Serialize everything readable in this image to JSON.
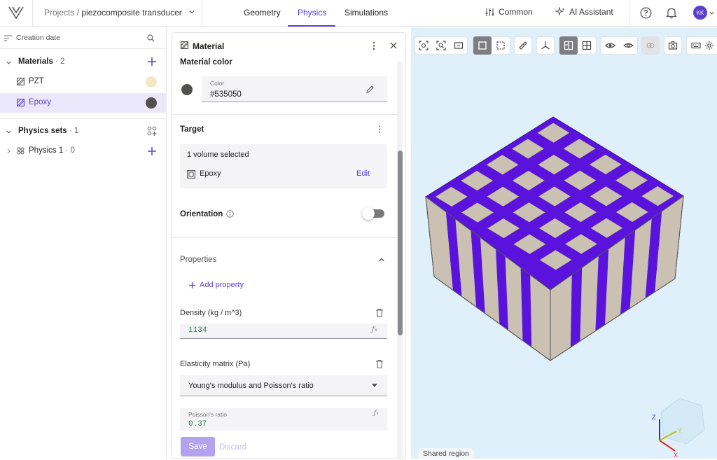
{
  "header": {
    "breadcrumb_root": "Projects",
    "breadcrumb_sep": " / ",
    "project_name": "piezocomposite transducer",
    "tabs": [
      {
        "label": "Geometry"
      },
      {
        "label": "Physics"
      },
      {
        "label": "Simulations"
      }
    ],
    "common_label": "Common",
    "assistant_label": "AI Assistant",
    "avatar_initials": "KK"
  },
  "sidebar": {
    "sort_label": "Creation date",
    "materials": {
      "title": "Materials",
      "count": "· 2"
    },
    "material_items": [
      {
        "label": "PZT",
        "color": "#f7e6c4"
      },
      {
        "label": "Epoxy",
        "color": "#535050"
      }
    ],
    "physics_sets": {
      "title": "Physics sets",
      "count": "· 1"
    },
    "physics_items": [
      {
        "label": "Physics 1",
        "count": "· 0"
      }
    ]
  },
  "panel": {
    "title": "Material",
    "material_color_heading": "Material color",
    "color_field_label": "Color",
    "color_value": "#535050",
    "target_heading": "Target",
    "selection_text": "1 volume selected",
    "volume_name": "Epoxy",
    "edit_label": "Edit",
    "orientation_label": "Orientation",
    "properties_heading": "Properties",
    "add_property_label": "Add property",
    "density_label": "Density (kg / m^3)",
    "density_value": "1134",
    "elasticity_label": "Elasticity matrix (Pa)",
    "elasticity_option": "Young's modulus and Poisson's ratio",
    "poisson_label": "Poisson's ratio",
    "poisson_value": "0.37",
    "save_label": "Save",
    "discard_label": "Discard"
  },
  "viewport": {
    "shared_region_label": "Shared region",
    "axis_labels": {
      "x": "X",
      "y": "Y",
      "z": "Z"
    },
    "colors": {
      "pzt": "#cbc1b2",
      "epoxy": "#5a12dd",
      "background": "#e0f0fb"
    }
  },
  "theme": {
    "accent": "#5a3fd0"
  }
}
